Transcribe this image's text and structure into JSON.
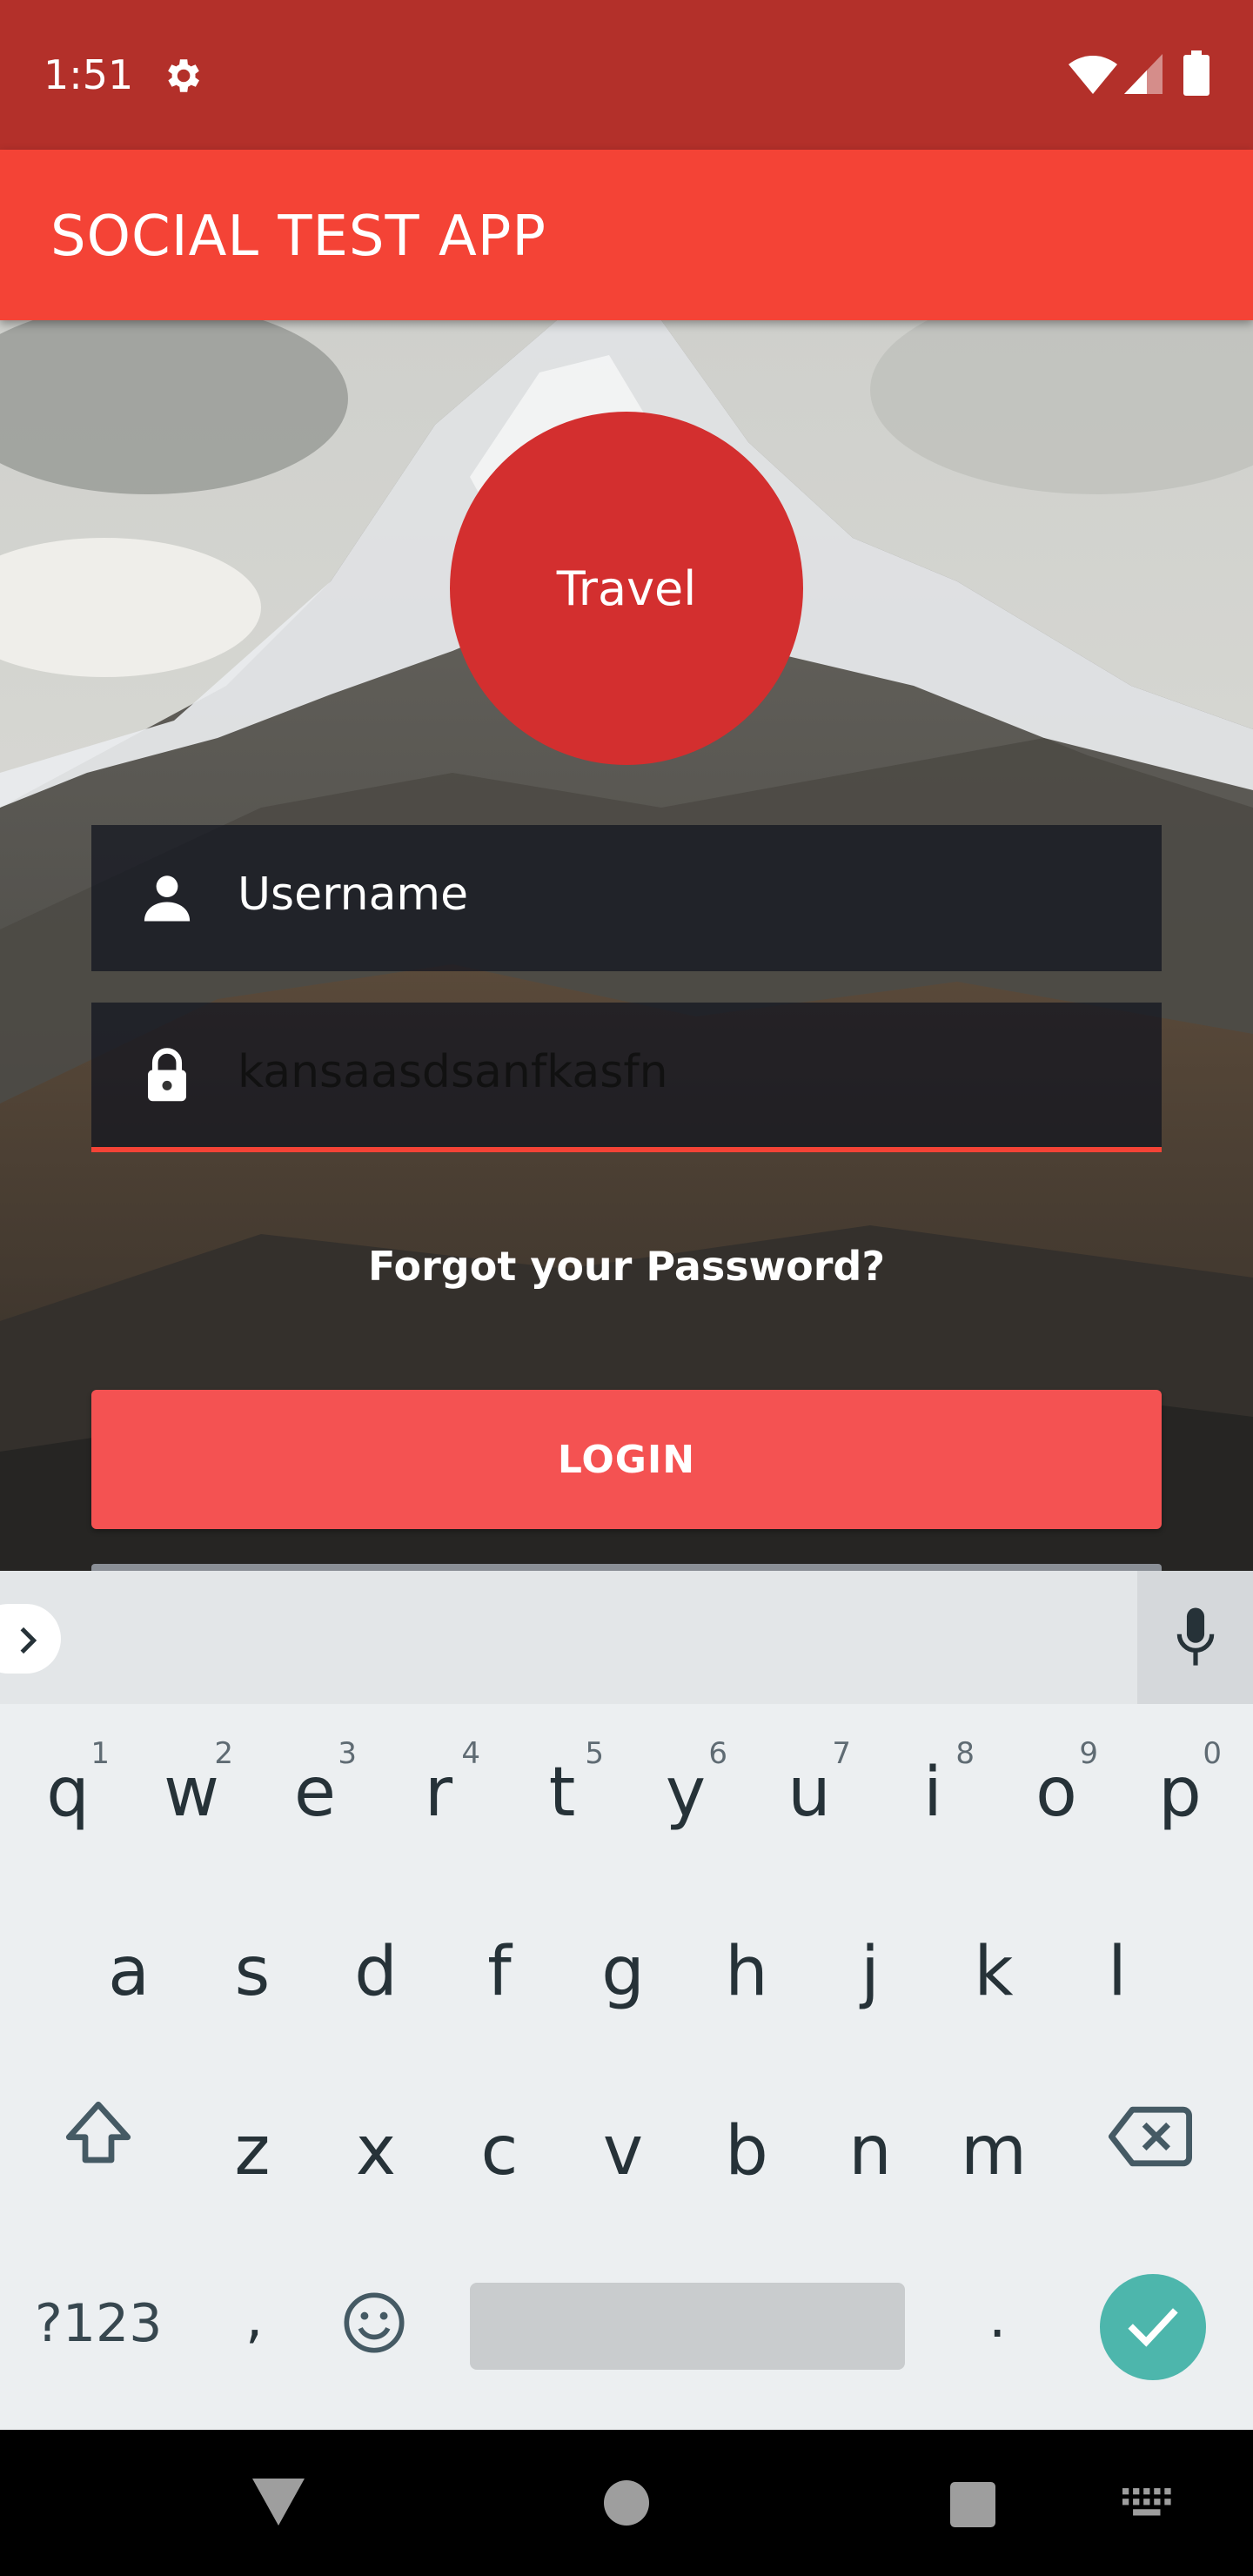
{
  "status_bar": {
    "time": "1:51",
    "icons": [
      "gear-icon",
      "wifi-icon",
      "signal-icon",
      "battery-icon"
    ]
  },
  "app_bar": {
    "title": "SOCIAL TEST APP"
  },
  "logo": {
    "label": "Travel",
    "color": "#d32f2f"
  },
  "form": {
    "username": {
      "placeholder": "Username",
      "icon": "person-icon"
    },
    "password": {
      "value": "kansaasdsanfkasfn",
      "icon": "lock-icon"
    },
    "forgot_link": "Forgot your Password?",
    "login_button": "LOGIN"
  },
  "keyboard": {
    "rows": [
      [
        {
          "key": "q",
          "hint": "1"
        },
        {
          "key": "w",
          "hint": "2"
        },
        {
          "key": "e",
          "hint": "3"
        },
        {
          "key": "r",
          "hint": "4"
        },
        {
          "key": "t",
          "hint": "5"
        },
        {
          "key": "y",
          "hint": "6"
        },
        {
          "key": "u",
          "hint": "7"
        },
        {
          "key": "i",
          "hint": "8"
        },
        {
          "key": "o",
          "hint": "9"
        },
        {
          "key": "p",
          "hint": "0"
        }
      ],
      [
        {
          "key": "a"
        },
        {
          "key": "s"
        },
        {
          "key": "d"
        },
        {
          "key": "f"
        },
        {
          "key": "g"
        },
        {
          "key": "h"
        },
        {
          "key": "j"
        },
        {
          "key": "k"
        },
        {
          "key": "l"
        }
      ],
      [
        {
          "key": "z"
        },
        {
          "key": "x"
        },
        {
          "key": "c"
        },
        {
          "key": "v"
        },
        {
          "key": "b"
        },
        {
          "key": "n"
        },
        {
          "key": "m"
        }
      ]
    ],
    "symbols_key": "?123",
    "comma_key": ",",
    "period_key": "."
  },
  "colors": {
    "status_bar": "#b3302a",
    "app_bar": "#f44336",
    "login_button": "#f45252",
    "enter_key": "#4db6ac"
  }
}
